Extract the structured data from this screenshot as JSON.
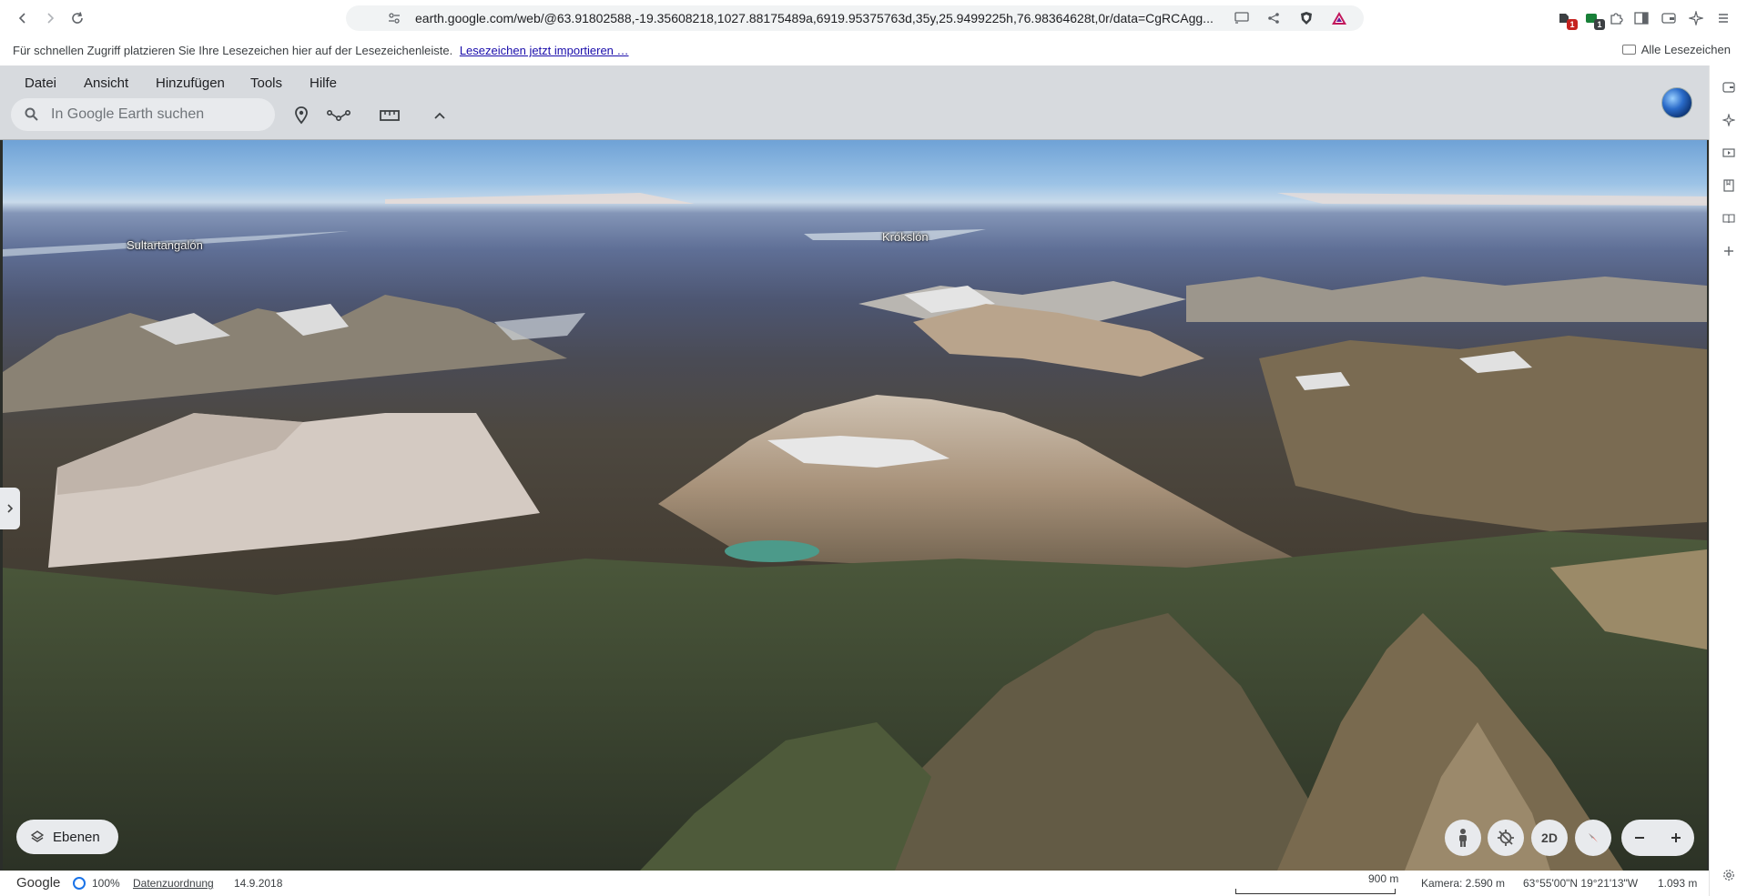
{
  "browser": {
    "url": "earth.google.com/web/@63.91802588,-19.35608218,1027.88175489a,6919.95375763d,35y,25.9499225h,76.98364628t,0r/data=CgRCAgg...",
    "ext_badge_1": "1",
    "ext_badge_2": "1"
  },
  "bookmarks": {
    "hint": "Für schnellen Zugriff platzieren Sie Ihre Lesezeichen hier auf der Lesezeichenleiste.",
    "import_link": "Lesezeichen jetzt importieren …",
    "all_bookmarks": "Alle Lesezeichen"
  },
  "menu": {
    "items": [
      "Datei",
      "Ansicht",
      "Hinzufügen",
      "Tools",
      "Hilfe"
    ]
  },
  "search": {
    "placeholder": "In Google Earth suchen"
  },
  "map": {
    "labels": {
      "sultartangalon": "Sultartangalón",
      "krokslon": "Krókslón"
    },
    "layers_label": "Ebenen",
    "view_mode_label": "2D"
  },
  "status": {
    "brand": "Google",
    "loading_percent": "100%",
    "attribution": "Datenzuordnung",
    "imagery_date": "14.9.2018",
    "scale_label": "900 m",
    "camera": "Kamera: 2.590 m",
    "coordinates": "63°55'00\"N 19°21'13\"W",
    "elevation": "1.093 m"
  },
  "colors": {
    "accent": "#1a73e8",
    "toolbar_bg": "#d7dade",
    "badge_red": "#c5221f",
    "badge_green": "#188038"
  }
}
